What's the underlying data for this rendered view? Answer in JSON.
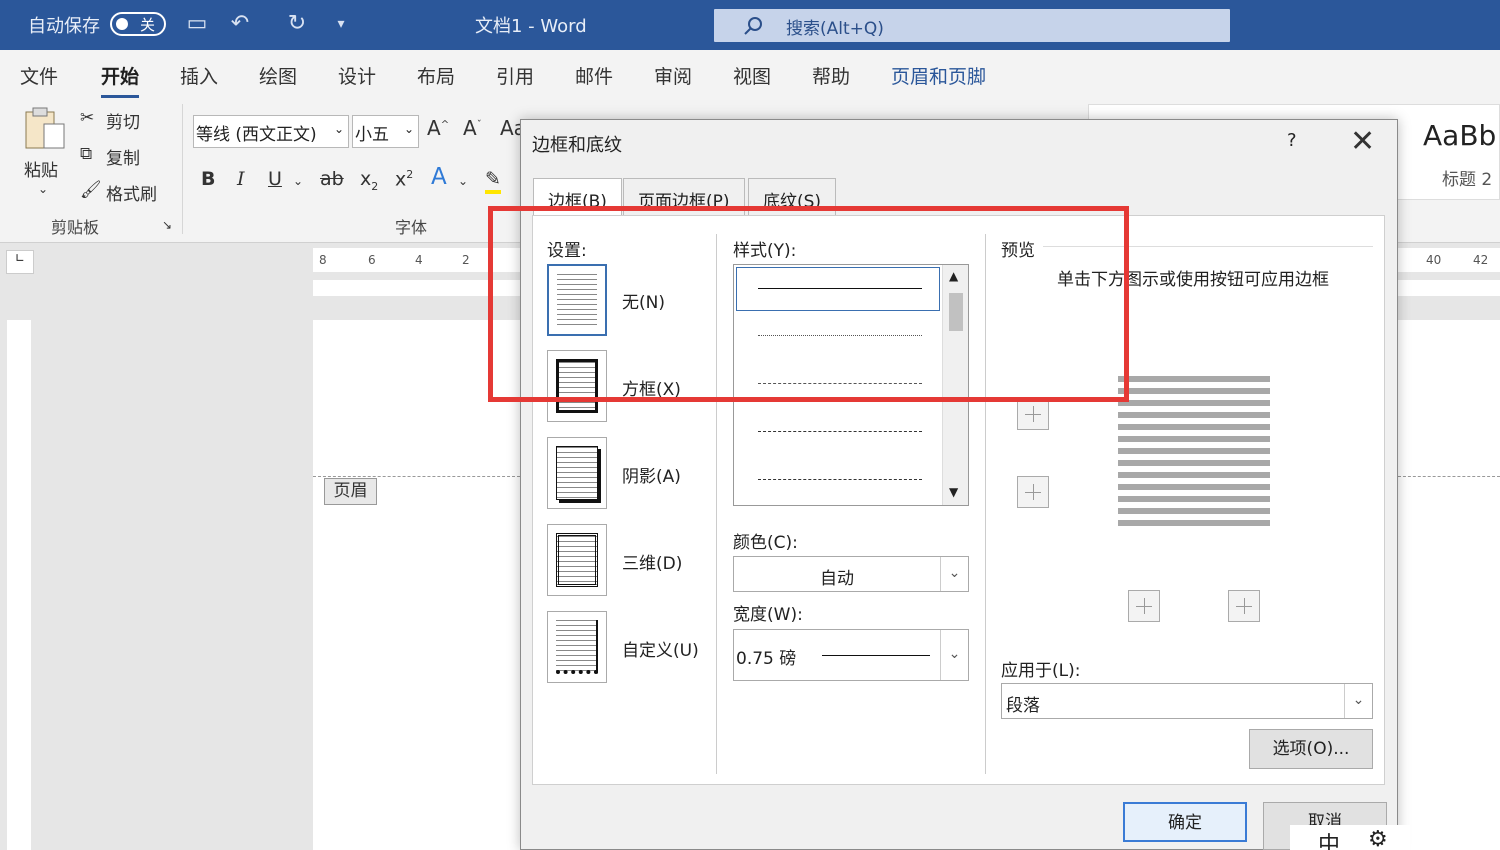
{
  "titlebar": {
    "autosave_label": "自动保存",
    "autosave_state": "关",
    "doc_title": "文档1  -  Word",
    "search_placeholder": "搜索(Alt+Q)"
  },
  "menus": [
    "文件",
    "开始",
    "插入",
    "绘图",
    "设计",
    "布局",
    "引用",
    "邮件",
    "审阅",
    "视图",
    "帮助",
    "页眉和页脚"
  ],
  "ribbon": {
    "paste": "粘贴",
    "cut": "剪切",
    "copy": "复制",
    "format_painter": "格式刷",
    "clipboard_group": "剪贴板",
    "font_name": "等线 (西文正文)",
    "font_size": "小五",
    "font_group": "字体",
    "style_sample": "AaBb",
    "style_name": "标题 2"
  },
  "document": {
    "header_tag": "页眉",
    "ruler_labels": [
      "8",
      "6",
      "4",
      "2",
      "40",
      "42"
    ]
  },
  "dialog": {
    "title": "边框和底纹",
    "help": "?",
    "tabs": [
      "边框(B)",
      "页面边框(P)",
      "底纹(S)"
    ],
    "settings_label": "设置:",
    "settings": [
      "无(N)",
      "方框(X)",
      "阴影(A)",
      "三维(D)",
      "自定义(U)"
    ],
    "style_label": "样式(Y):",
    "color_label": "颜色(C):",
    "color_value": "自动",
    "width_label": "宽度(W):",
    "width_value": "0.75 磅",
    "preview_label": "预览",
    "preview_hint": "单击下方图示或使用按钮可应用边框",
    "apply_label": "应用于(L):",
    "apply_value": "段落",
    "options_button": "选项(O)...",
    "ok_button": "确定",
    "cancel_button": "取消"
  },
  "tray": {
    "ime": "中"
  },
  "colors": {
    "titlebar": "#2b579a",
    "highlight": "#e53935"
  }
}
